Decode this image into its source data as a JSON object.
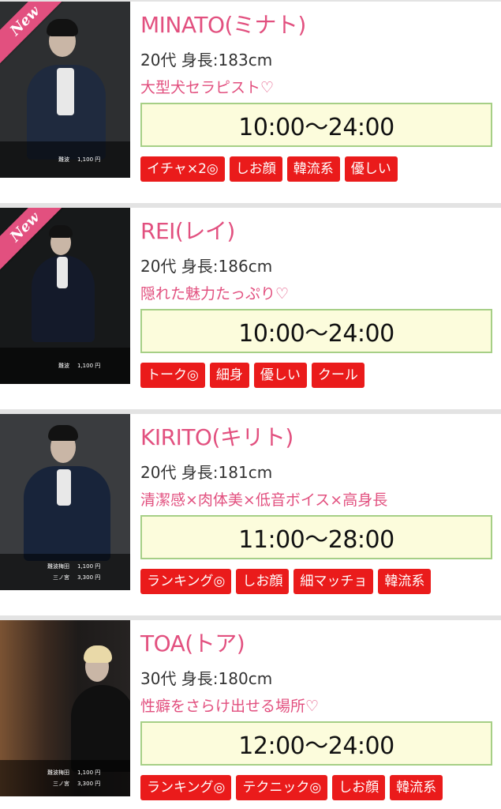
{
  "cards": [
    {
      "is_new": true,
      "new_label": "New",
      "name": "MINATO(ミナト)",
      "stats": "20代 身長:183cm",
      "catch": "大型犬セラピスト♡",
      "hours": "10:00〜24:00",
      "tags": [
        "イチャ×2◎",
        "しお顔",
        "韓流系",
        "優しい"
      ],
      "prices": [
        {
          "area": "難波",
          "price": "1,100 円"
        }
      ]
    },
    {
      "is_new": true,
      "new_label": "New",
      "name": "REI(レイ)",
      "stats": "20代 身長:186cm",
      "catch": "隠れた魅力たっぷり♡",
      "hours": "10:00〜24:00",
      "tags": [
        "トーク◎",
        "細身",
        "優しい",
        "クール"
      ],
      "prices": [
        {
          "area": "難波",
          "price": "1,100 円"
        }
      ]
    },
    {
      "is_new": false,
      "new_label": "",
      "name": "KIRITO(キリト)",
      "stats": "20代 身長:181cm",
      "catch": "清潔感×肉体美×低音ボイス×高身長",
      "hours": "11:00〜28:00",
      "tags": [
        "ランキング◎",
        "しお顔",
        "細マッチョ",
        "韓流系"
      ],
      "prices": [
        {
          "area": "難波梅田",
          "price": "1,100 円"
        },
        {
          "area": "三ノ宮",
          "price": "3,300 円"
        }
      ]
    },
    {
      "is_new": false,
      "new_label": "",
      "name": "TOA(トア)",
      "stats": "30代 身長:180cm",
      "catch": "性癖をさらけ出せる場所♡",
      "hours": "12:00〜24:00",
      "tags": [
        "ランキング◎",
        "テクニック◎",
        "しお顔",
        "韓流系"
      ],
      "prices": [
        {
          "area": "難波梅田",
          "price": "1,100 円"
        },
        {
          "area": "三ノ宮",
          "price": "3,300 円"
        }
      ]
    }
  ],
  "colors": {
    "accent_pink": "#e2507f",
    "tag_red": "#ea1b1b",
    "hours_bg": "#fcfcdc",
    "hours_border": "#a6cf86"
  }
}
